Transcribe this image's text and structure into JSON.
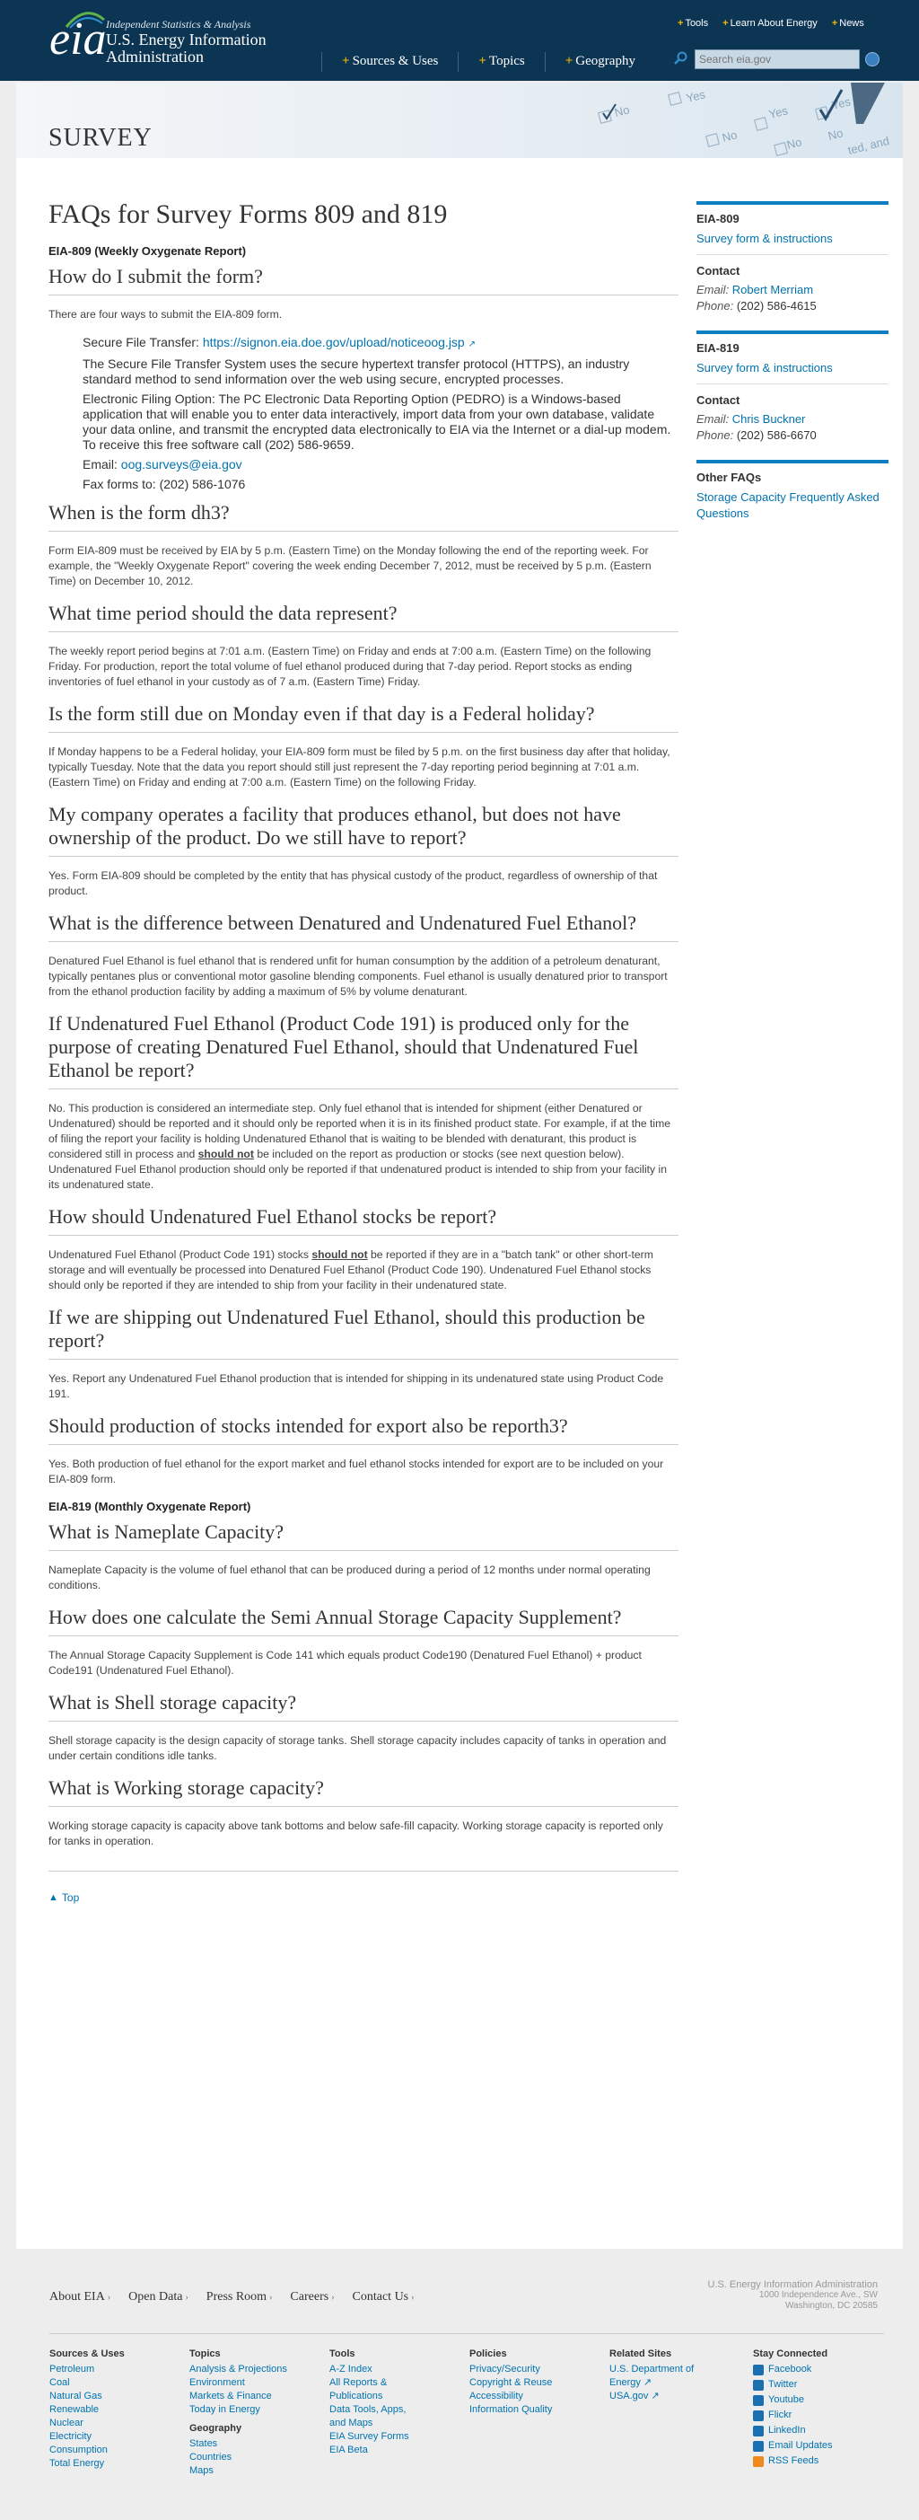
{
  "header": {
    "tagline": "Independent Statistics & Analysis",
    "agency_line1": "U.S. Energy Information",
    "agency_line2": "Administration",
    "logo_text": "eia",
    "nav": [
      {
        "label": "Sources & Uses"
      },
      {
        "label": "Topics"
      },
      {
        "label": "Geography"
      }
    ],
    "util": [
      {
        "label": "Tools"
      },
      {
        "label": "Learn About Energy"
      },
      {
        "label": "News"
      }
    ],
    "search_placeholder": "Search eia.gov"
  },
  "banner": {
    "title": "SURVEY",
    "form_words": [
      "No",
      "Yes",
      "No",
      "Yes",
      "No",
      "Yes",
      "No",
      "ted, and"
    ]
  },
  "main": {
    "title": "FAQs for Survey Forms 809 and 819",
    "section809": "EIA-809 (Weekly Oxygenate Report)",
    "q1": "How do I submit the form?",
    "q1_intro": "There are four ways to submit the EIA-809 form.",
    "sft_label": "Secure File Transfer: ",
    "sft_link": "https://signon.eia.doe.gov/upload/noticeoog.jsp",
    "sft_desc": "The Secure File Transfer System uses the secure hypertext transfer protocol (HTTPS), an industry standard method to send information over the web using secure, encrypted processes.",
    "efo": "Electronic Filing Option: The PC Electronic Data Reporting Option (PEDRO) is a Windows-based application that will enable you to enter data interactively, import data from your own database, validate your data online, and transmit the encrypted data electronically to EIA via the Internet or a dial-up modem. To receive this free software call (202) 586-9659.",
    "email_label": "Email: ",
    "email_link": "oog.surveys@eia.gov",
    "fax": "Fax forms to: (202) 586-1076",
    "q2": "When is the form dh3?",
    "a2": "Form EIA-809 must be received by EIA by 5 p.m. (Eastern Time) on the Monday following the end of the reporting week. For example, the \"Weekly Oxygenate Report\" covering the week ending December 7, 2012, must be received by 5 p.m. (Eastern Time) on December 10, 2012.",
    "q3": "What time period should the data represent?",
    "a3": "The weekly report period begins at 7:01 a.m. (Eastern Time) on Friday and ends at 7:00 a.m. (Eastern Time) on the following Friday. For production, report the total volume of fuel ethanol produced during that 7-day period. Report stocks as ending inventories of fuel ethanol in your custody as of 7 a.m. (Eastern Time) Friday.",
    "q4": "Is the form still due on Monday even if that day is a Federal holiday?",
    "a4": "If Monday happens to be a Federal holiday, your EIA-809 form must be filed by 5 p.m. on the first business day after that holiday, typically Tuesday. Note that the data you report should still just represent the 7-day reporting period beginning at 7:01 a.m. (Eastern Time) on Friday and ending at 7:00 a.m. (Eastern Time) on the following Friday.",
    "q5": "My company operates a facility that produces ethanol, but does not have ownership of the product. Do we still have to report?",
    "a5": "Yes. Form EIA-809 should be completed by the entity that has physical custody of the product, regardless of ownership of that product.",
    "q6": "What is the difference between Denatured and Undenatured Fuel Ethanol?",
    "a6": "Denatured Fuel Ethanol is fuel ethanol that is rendered unfit for human consumption by the addition of a petroleum denaturant, typically pentanes plus or conventional motor gasoline blending components. Fuel ethanol is usually denatured prior to transport from the ethanol production facility by adding a maximum of 5% by volume denaturant.",
    "q7": "If Undenatured Fuel Ethanol (Product Code 191) is produced only for the purpose of creating Denatured Fuel Ethanol, should that Undenatured Fuel Ethanol be report?",
    "a7_part1": "No. This production is considered an intermediate step. Only fuel ethanol that is intended for shipment (either Denatured or Undenatured) should be reported and it should only be reported when it is in its finished product state. For example, if at the time of filing the report your facility is holding Undenatured Ethanol that is waiting to be blended with denaturant, this product is considered still in process and ",
    "a7_bold": "should not",
    "a7_part2": " be included on the report as production or stocks (see next question below). Undenatured Fuel Ethanol production should only be reported if that undenatured product is intended to ship from your facility in its undenatured state.",
    "q8": "How should Undenatured Fuel Ethanol stocks be report?",
    "a8_part1": "Undenatured Fuel Ethanol (Product Code 191) stocks ",
    "a8_bold": "should not",
    "a8_part2": " be reported if they are in a \"batch tank\" or other short-term storage and will eventually be processed into Denatured Fuel Ethanol (Product Code 190). Undenatured Fuel Ethanol stocks should only be reported if they are intended to ship from your facility in their undenatured state.",
    "q9": "If we are shipping out Undenatured Fuel Ethanol, should this production be report?",
    "a9": "Yes. Report any Undenatured Fuel Ethanol production that is intended for shipping in its undenatured state using Product Code 191.",
    "q10": "Should production of stocks intended for export also be reporth3?",
    "a10": "Yes. Both production of fuel ethanol for the export market and fuel ethanol stocks intended for export are to be included on your EIA-809 form.",
    "section819": "EIA-819 (Monthly Oxygenate Report)",
    "q11": "What is Nameplate Capacity?",
    "a11": "Nameplate Capacity is the volume of fuel ethanol that can be produced during a period of 12 months under normal operating conditions.",
    "q12": "How does one calculate the Semi Annual Storage Capacity Supplement?",
    "a12": "The Annual Storage Capacity Supplement is Code 141 which equals product Code190 (Denatured Fuel Ethanol) + product Code191 (Undenatured Fuel Ethanol).",
    "q13": "What is Shell storage capacity?",
    "a13": "Shell storage capacity is the design capacity of storage tanks. Shell storage capacity includes capacity of tanks in operation and under certain conditions idle tanks.",
    "q14": "What is Working storage capacity?",
    "a14": "Working storage capacity is capacity above tank bottoms and below safe-fill capacity. Working storage capacity is reported only for tanks in operation.",
    "top": "Top"
  },
  "sidebar": {
    "box1_title": "EIA-809",
    "box1_link": "Survey form & instructions",
    "box1_contact": "Contact",
    "box1_email_label": "Email: ",
    "box1_email": "Robert Merriam",
    "box1_phone_label": "Phone: ",
    "box1_phone": "(202) 586-4615",
    "box2_title": "EIA-819",
    "box2_link": "Survey form & instructions",
    "box2_contact": "Contact",
    "box2_email_label": "Email: ",
    "box2_email": "Chris Buckner",
    "box2_phone_label": "Phone: ",
    "box2_phone": "(202) 586-6670",
    "box3_title": "Other FAQs",
    "box3_link": "Storage Capacity Frequently Asked Questions"
  },
  "footer": {
    "nav": [
      {
        "label": "About EIA"
      },
      {
        "label": "Open Data"
      },
      {
        "label": "Press Room"
      },
      {
        "label": "Careers"
      },
      {
        "label": "Contact Us"
      }
    ],
    "addr1": "U.S. Energy Information Administration",
    "addr2": "1000 Independence Ave., SW",
    "addr3": "Washington, DC 20585",
    "col_sources": {
      "title": "Sources & Uses",
      "items": [
        "Petroleum",
        "Coal",
        "Natural Gas",
        "Renewable",
        "Nuclear",
        "Electricity",
        "Consumption",
        "Total Energy"
      ]
    },
    "col_topics": {
      "title": "Topics",
      "items": [
        "Analysis & Projections",
        "Environment",
        "Markets & Finance",
        "Today in Energy"
      ],
      "geo_title": "Geography",
      "geo_items": [
        "States",
        "Countries",
        "Maps"
      ]
    },
    "col_tools": {
      "title": "Tools",
      "items": [
        "A-Z Index",
        "All Reports & Publications",
        "Data Tools, Apps, and Maps",
        "EIA Survey Forms",
        "EIA Beta"
      ]
    },
    "col_policies": {
      "title": "Policies",
      "items": [
        "Privacy/Security",
        "Copyright & Reuse",
        "Accessibility",
        "Information Quality"
      ]
    },
    "col_related": {
      "title": "Related Sites",
      "items": [
        "U.S. Department of Energy",
        "USA.gov"
      ]
    },
    "col_social": {
      "title": "Stay Connected",
      "items": [
        "Facebook",
        "Twitter",
        "Youtube",
        "Flickr",
        "LinkedIn",
        "Email Updates",
        "RSS Feeds"
      ]
    }
  }
}
